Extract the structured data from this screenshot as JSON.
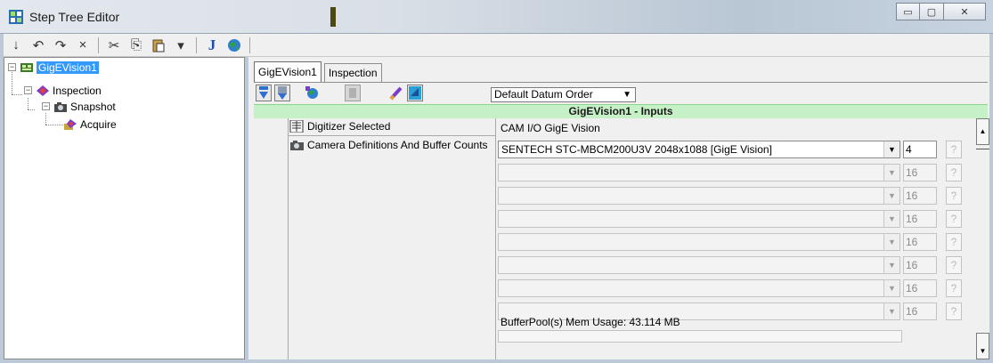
{
  "window": {
    "title": "Step Tree Editor",
    "controls": {
      "minimize": "▭",
      "maximize": "▢",
      "close": "✕"
    }
  },
  "toolbar": {
    "items": [
      {
        "name": "insert-below-icon",
        "glyph": "↓"
      },
      {
        "name": "undo-icon",
        "glyph": "↶"
      },
      {
        "name": "redo-icon",
        "glyph": "↷"
      },
      {
        "name": "delete-icon",
        "glyph": "×"
      },
      {
        "name": "cut-icon",
        "glyph": "✂"
      },
      {
        "name": "copy-icon",
        "glyph": "⎘"
      },
      {
        "name": "paste-icon",
        "glyph": "📋"
      },
      {
        "name": "paste-dropdown-icon",
        "glyph": "▾"
      },
      {
        "name": "j-icon",
        "glyph": "J"
      },
      {
        "name": "globe-icon",
        "glyph": "●"
      }
    ]
  },
  "tree": {
    "nodes": [
      {
        "label": "GigEVision1",
        "selected": true,
        "expander": "−"
      },
      {
        "label": "Inspection",
        "selected": false,
        "expander": "−"
      },
      {
        "label": "Snapshot",
        "selected": false,
        "expander": "−"
      },
      {
        "label": "Acquire",
        "selected": false,
        "expander": ""
      }
    ]
  },
  "tabs": [
    {
      "label": "GigEVision1",
      "active": true
    },
    {
      "label": "Inspection",
      "active": false
    }
  ],
  "datum_order": {
    "value": "Default Datum Order"
  },
  "section_header": "GigEVision1 - Inputs",
  "fields": {
    "digitizer": {
      "label": "Digitizer Selected",
      "value": "CAM I/O GigE Vision"
    },
    "camera": {
      "label": "Camera Definitions And Buffer Counts"
    }
  },
  "camera_rows": [
    {
      "camera": "SENTECH STC-MBCM200U3V 2048x1088 [GigE Vision]",
      "count": "4",
      "enabled": true
    },
    {
      "camera": "",
      "count": "16",
      "enabled": false
    },
    {
      "camera": "",
      "count": "16",
      "enabled": false
    },
    {
      "camera": "",
      "count": "16",
      "enabled": false
    },
    {
      "camera": "",
      "count": "16",
      "enabled": false
    },
    {
      "camera": "",
      "count": "16",
      "enabled": false
    },
    {
      "camera": "",
      "count": "16",
      "enabled": false
    },
    {
      "camera": "",
      "count": "16",
      "enabled": false
    }
  ],
  "help_glyph": "?",
  "dropdown_glyph": "▼",
  "buffer_mem": "BufferPool(s) Mem Usage: 43.114 MB",
  "colors": {
    "selection": "#3399ff",
    "inputs_header": "#c6f0c6"
  }
}
